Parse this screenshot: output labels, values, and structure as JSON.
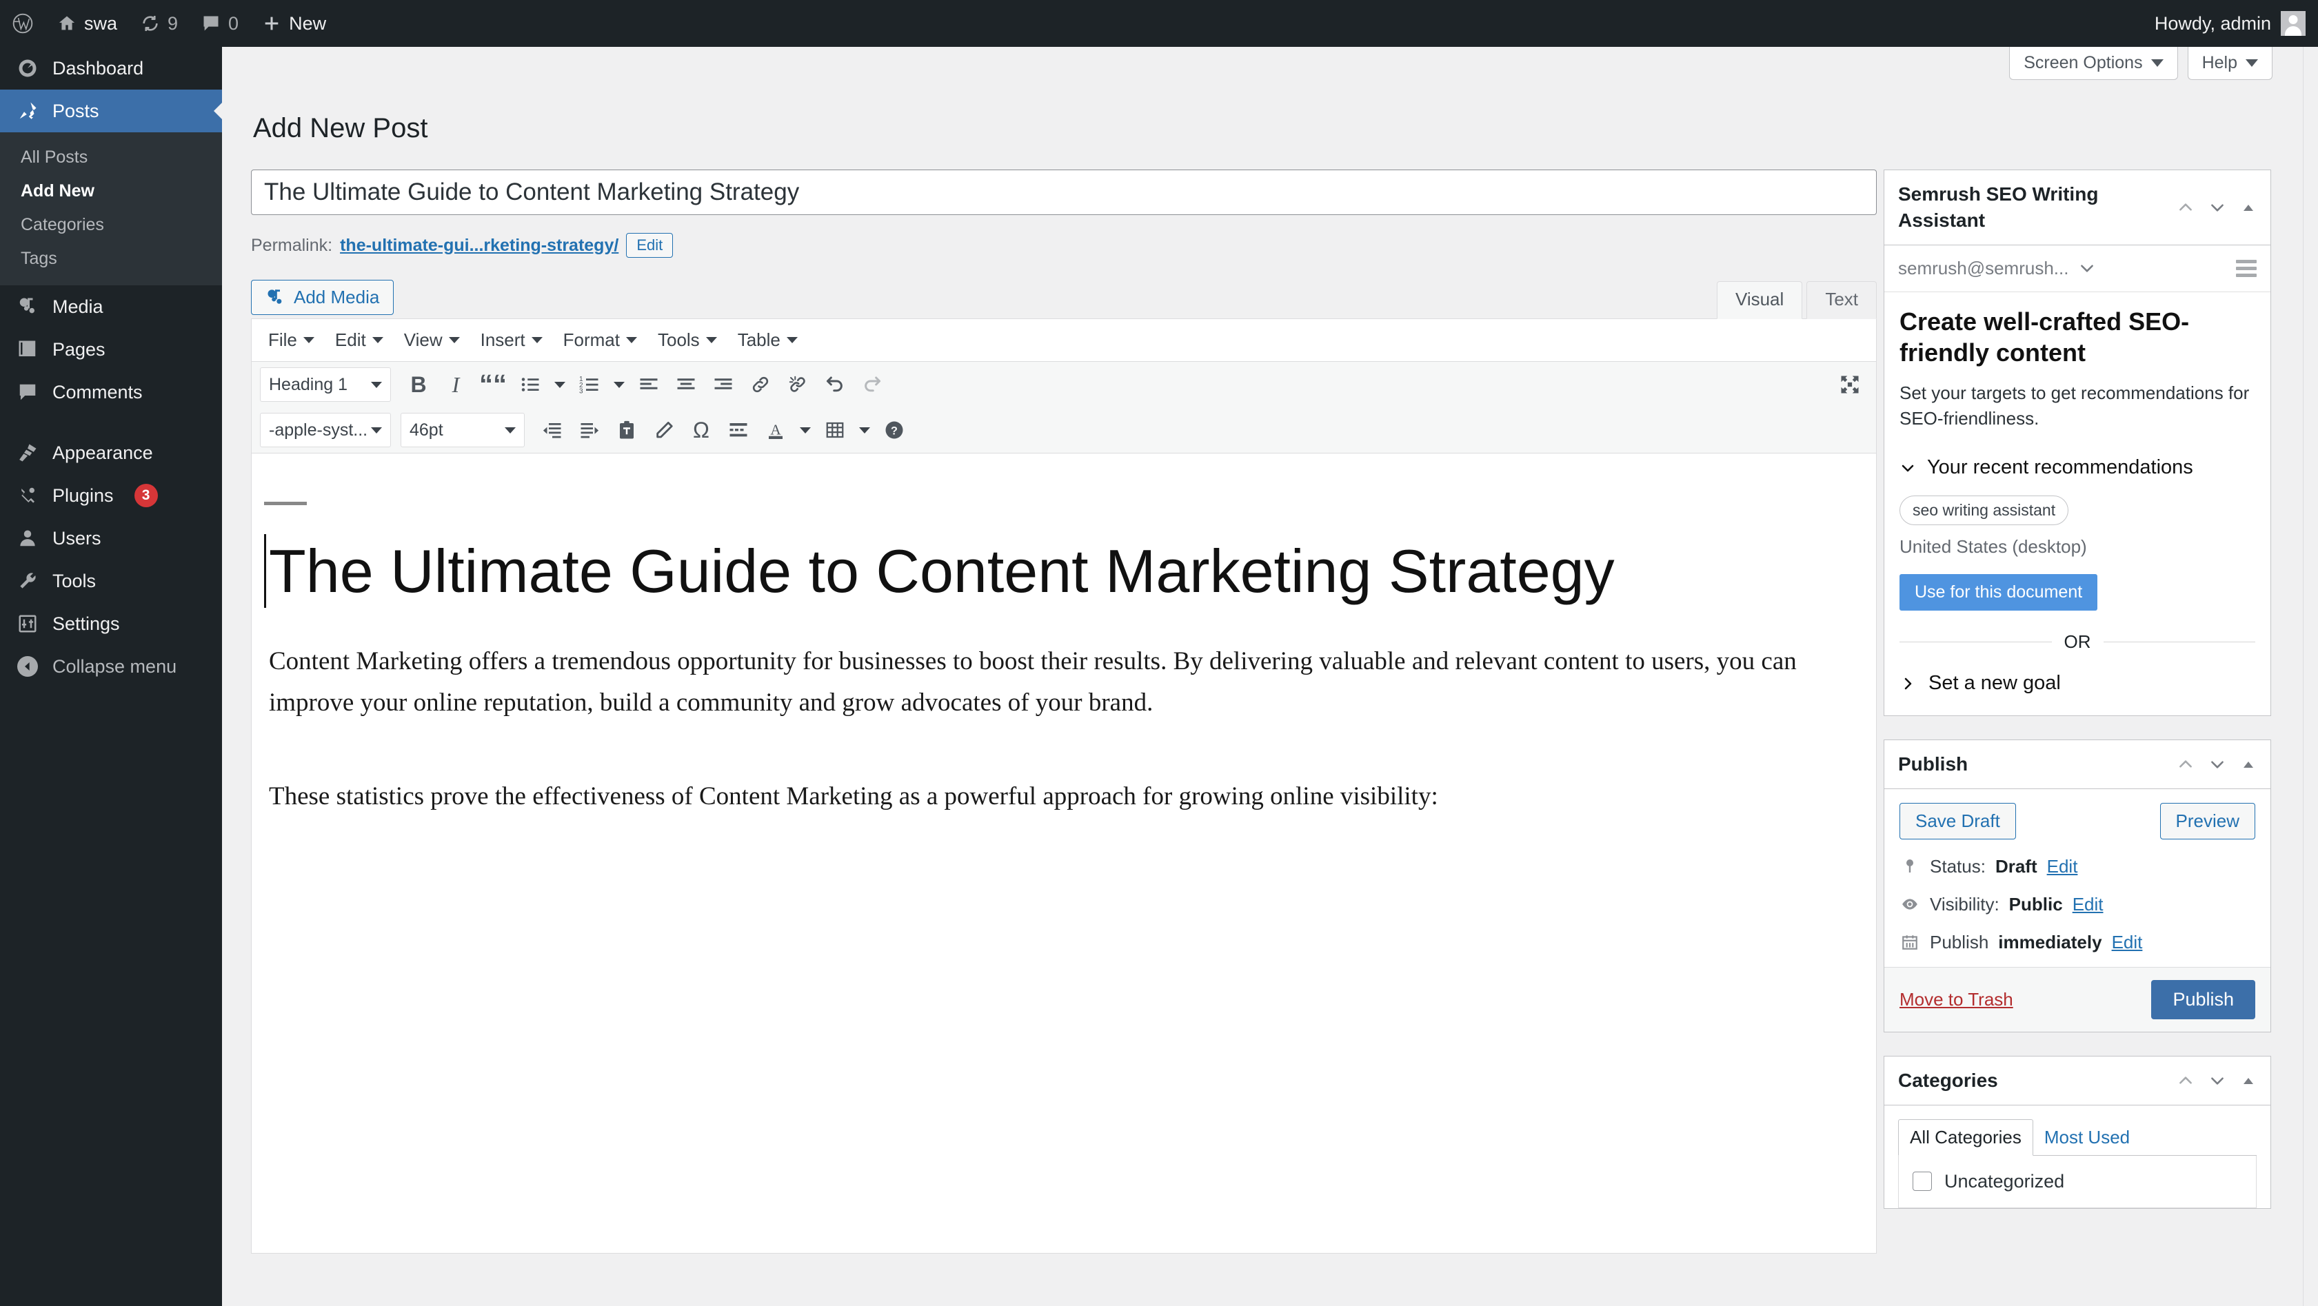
{
  "adminbar": {
    "wp_logo_icon": "wordpress-logo-icon",
    "site_name": "swa",
    "updates_count": "9",
    "comments_count": "0",
    "new_label": "New",
    "howdy": "Howdy, admin"
  },
  "sidebar": {
    "items": [
      {
        "label": "Dashboard",
        "icon": "dashboard-icon",
        "current": false
      },
      {
        "label": "Posts",
        "icon": "pin-icon",
        "current": true
      },
      {
        "label": "Media",
        "icon": "media-icon",
        "current": false
      },
      {
        "label": "Pages",
        "icon": "pages-icon",
        "current": false
      },
      {
        "label": "Comments",
        "icon": "comments-icon",
        "current": false
      },
      {
        "label": "Appearance",
        "icon": "paintbrush-icon",
        "current": false
      },
      {
        "label": "Plugins",
        "icon": "plug-icon",
        "current": false,
        "badge": "3"
      },
      {
        "label": "Users",
        "icon": "user-icon",
        "current": false
      },
      {
        "label": "Tools",
        "icon": "wrench-icon",
        "current": false
      },
      {
        "label": "Settings",
        "icon": "sliders-icon",
        "current": false
      }
    ],
    "submenu": [
      {
        "label": "All Posts",
        "active": false
      },
      {
        "label": "Add New",
        "active": true
      },
      {
        "label": "Categories",
        "active": false
      },
      {
        "label": "Tags",
        "active": false
      }
    ],
    "collapse_label": "Collapse menu"
  },
  "screen_meta": {
    "screen_options": "Screen Options",
    "help": "Help"
  },
  "page": {
    "title": "Add New Post"
  },
  "post": {
    "title_value": "The Ultimate Guide to Content Marketing Strategy",
    "permalink_label": "Permalink:",
    "permalink_slug": "the-ultimate-gui...rketing-strategy/",
    "permalink_edit": "Edit",
    "add_media": "Add Media",
    "tabs": [
      {
        "label": "Visual",
        "active": true
      },
      {
        "label": "Text",
        "active": false
      }
    ]
  },
  "editor": {
    "menubar": [
      "File",
      "Edit",
      "View",
      "Insert",
      "Format",
      "Tools",
      "Table"
    ],
    "block_format": "Heading 1",
    "font_family": "-apple-syst...",
    "font_size": "46pt",
    "toolbar_row1": [
      "bold-icon",
      "italic-icon",
      "blockquote-icon",
      "bulleted-list-icon",
      "bulleted-list-caret-icon",
      "numbered-list-icon",
      "numbered-list-caret-icon",
      "align-left-icon",
      "align-center-icon",
      "align-right-icon",
      "insert-link-icon",
      "unlink-icon",
      "undo-icon",
      "redo-icon"
    ],
    "toolbar_row2": [
      "outdent-icon",
      "indent-icon",
      "paste-as-text-icon",
      "clear-formatting-icon",
      "special-character-icon",
      "horizontal-line-icon",
      "text-color-icon",
      "text-color-caret-icon",
      "table-icon",
      "table-caret-icon",
      "keyboard-shortcuts-icon"
    ],
    "fullscreen_icon": "fullscreen-icon",
    "content": {
      "heading": "The Ultimate Guide to Content Marketing Strategy",
      "paragraph_1": "Content Marketing offers a tremendous opportunity for businesses to boost their results. By delivering valuable and relevant content to users, you can improve your online reputation, build a community and grow advocates of your brand.",
      "paragraph_2": "These statistics prove the effectiveness of Content Marketing as a powerful approach for growing online visibility:"
    }
  },
  "swa": {
    "panel_title": "Semrush SEO Writing Assistant",
    "account": "semrush@semrush...",
    "headline": "Create well-crafted SEO-friendly content",
    "subtext": "Set your targets to get recommendations for SEO-friendliness.",
    "recent_label": "Your recent recommendations",
    "keyword_pill": "seo writing assistant",
    "location": "United States (desktop)",
    "use_button": "Use for this document",
    "or_label": "OR",
    "new_goal_label": "Set a new goal"
  },
  "publish": {
    "panel_title": "Publish",
    "save_draft": "Save Draft",
    "preview": "Preview",
    "status_label": "Status:",
    "status_value": "Draft",
    "status_edit": "Edit",
    "visibility_label": "Visibility:",
    "visibility_value": "Public",
    "visibility_edit": "Edit",
    "schedule_label": "Publish",
    "schedule_value": "immediately",
    "schedule_edit": "Edit",
    "move_to_trash": "Move to Trash",
    "publish_button": "Publish"
  },
  "categories": {
    "panel_title": "Categories",
    "tabs": [
      {
        "label": "All Categories",
        "active": true
      },
      {
        "label": "Most Used",
        "active": false
      }
    ],
    "items": [
      {
        "label": "Uncategorized",
        "checked": false
      }
    ]
  },
  "colors": {
    "admin_dark": "#1d2327",
    "sidebar_submenu": "#2c3338",
    "accent_blue": "#3c6fa9",
    "link_blue": "#2271b1",
    "semrush_blue": "#4f94e0",
    "badge_red": "#d63638",
    "trash_red": "#b32d2e",
    "canvas": "#f0f0f1"
  }
}
